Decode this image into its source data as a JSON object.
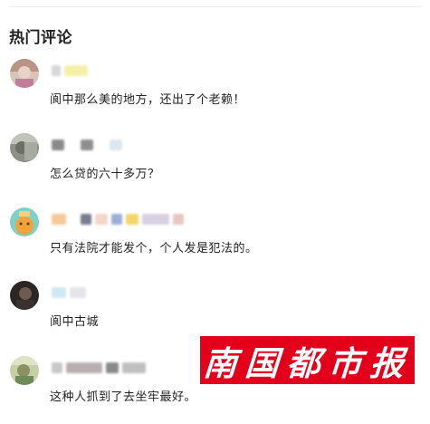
{
  "section": {
    "title": "热门评论"
  },
  "comments": [
    {
      "text": "阆中那么美的地方，还出了个老赖！",
      "avatar_icon": "user-avatar-icon"
    },
    {
      "text": "怎么贷的六十多万？",
      "avatar_icon": "user-avatar-icon"
    },
    {
      "text": "只有法院才能发个，个人发是犯法的。",
      "avatar_icon": "user-avatar-icon"
    },
    {
      "text": "阆中古城",
      "avatar_icon": "user-avatar-icon"
    },
    {
      "text": "这种人抓到了去坐牢最好。",
      "avatar_icon": "user-avatar-icon"
    }
  ],
  "watermark": {
    "text": "南国都市报",
    "background": "#e3001b"
  },
  "colors": {
    "text": "#222222",
    "divider": "#ececec"
  }
}
